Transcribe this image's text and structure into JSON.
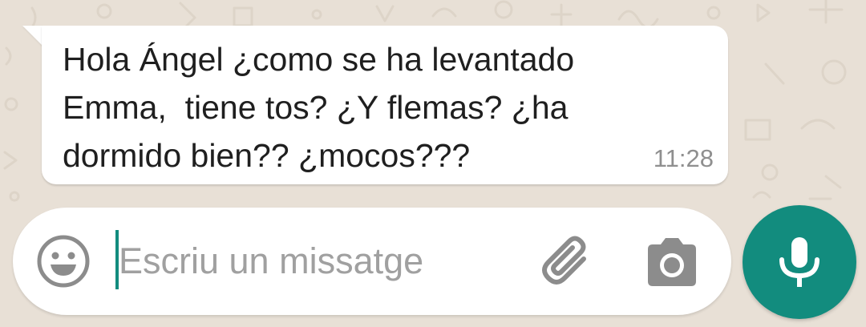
{
  "chat": {
    "message": {
      "text": "Hola Ángel ¿como se ha levantado\nEmma,  tiene tos? ¿Y flemas? ¿ha\ndormido bien?? ¿mocos???",
      "time": "11:28",
      "direction": "incoming"
    }
  },
  "composer": {
    "placeholder": "Escriu un missatge",
    "value": "",
    "icons": {
      "emoji": "emoji-icon",
      "attach": "paperclip-icon",
      "camera": "camera-icon",
      "mic": "microphone-icon"
    }
  },
  "colors": {
    "wallpaper": "#e8e0d6",
    "bubble": "#ffffff",
    "accent": "#128c7e",
    "timestamp": "#8f8f8f",
    "placeholder": "#a0a0a0",
    "icon": "#8c8c8c"
  }
}
